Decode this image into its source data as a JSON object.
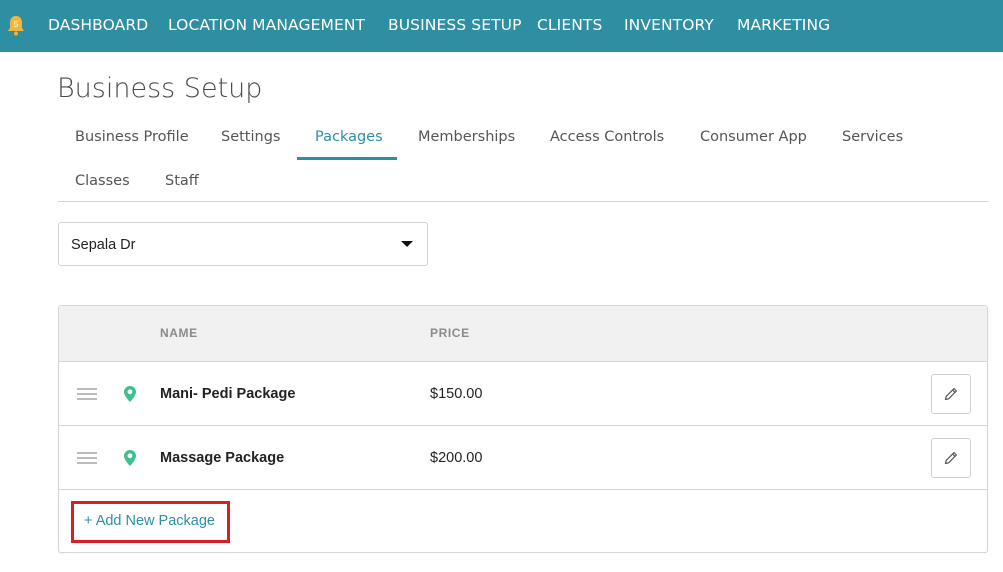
{
  "topnav": {
    "bell_icon": "notification-bell-icon",
    "items": [
      "DASHBOARD",
      "LOCATION MANAGEMENT",
      "BUSINESS SETUP",
      "CLIENTS",
      "INVENTORY",
      "MARKETING"
    ]
  },
  "page": {
    "title": "Business Setup"
  },
  "tabs": {
    "items": [
      "Business Profile",
      "Settings",
      "Packages",
      "Memberships",
      "Access Controls",
      "Consumer App",
      "Services",
      "Classes",
      "Staff"
    ],
    "active": "Packages"
  },
  "location_select": {
    "value": "Sepala Dr"
  },
  "table": {
    "headers": {
      "name": "NAME",
      "price": "PRICE"
    },
    "rows": [
      {
        "name": "Mani- Pedi Package",
        "price": "$150.00"
      },
      {
        "name": "Massage Package",
        "price": "$200.00"
      }
    ]
  },
  "add_link": "+ Add New Package",
  "colors": {
    "accent": "#2e8fa3",
    "pin": "#3fc18e",
    "highlight": "#d81f26"
  }
}
